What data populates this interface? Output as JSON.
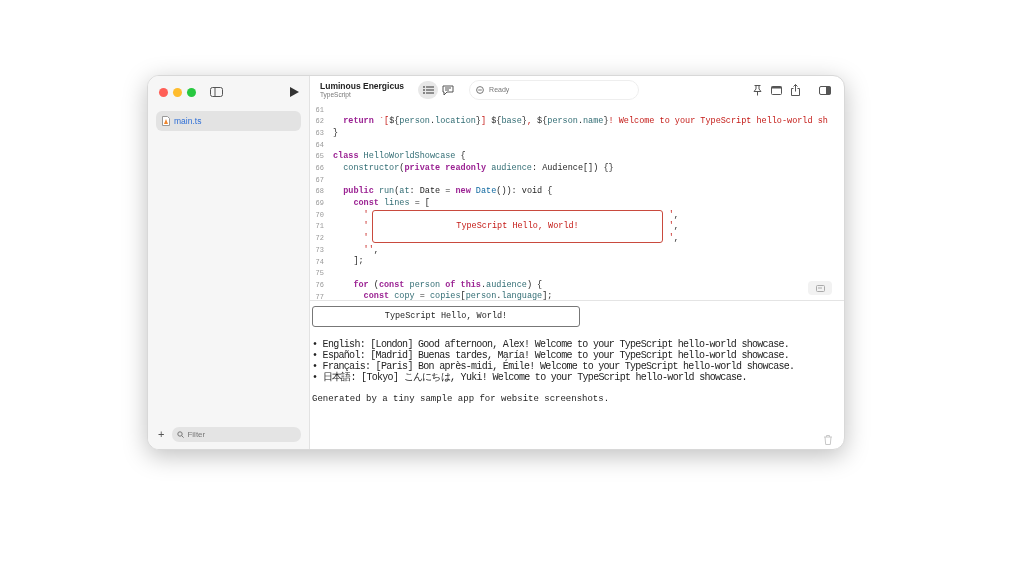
{
  "sidebar": {
    "files": [
      {
        "name": "main.ts",
        "selected": true
      }
    ],
    "filter": {
      "placeholder": "Filter"
    },
    "add_label": "+"
  },
  "toolbar": {
    "title": "Luminous Energicus",
    "subtitle": "TypeScript",
    "status": "Ready",
    "list_selected": true
  },
  "editor": {
    "lines": [
      {
        "num": "61",
        "kind": "code"
      },
      {
        "num": "62",
        "kind": "code",
        "tokens": [
          {
            "kind": "kw",
            "text": "  return"
          },
          {
            "kind": "str",
            "text": " `["
          },
          {
            "kind": "plain",
            "text": "${"
          },
          {
            "kind": "id",
            "text": "person"
          },
          {
            "kind": "plain",
            "text": "."
          },
          {
            "kind": "id",
            "text": "location"
          },
          {
            "kind": "plain",
            "text": "}"
          },
          {
            "kind": "str",
            "text": "] "
          },
          {
            "kind": "plain",
            "text": "${"
          },
          {
            "kind": "id",
            "text": "base"
          },
          {
            "kind": "plain",
            "text": "}"
          },
          {
            "kind": "str",
            "text": ", "
          },
          {
            "kind": "plain",
            "text": "${"
          },
          {
            "kind": "id",
            "text": "person"
          },
          {
            "kind": "plain",
            "text": "."
          },
          {
            "kind": "id",
            "text": "name"
          },
          {
            "kind": "plain",
            "text": "}"
          },
          {
            "kind": "str",
            "text": "! Welcome to your TypeScript hello-world sh"
          }
        ]
      },
      {
        "num": "63",
        "kind": "code",
        "tokens": [
          {
            "kind": "plain",
            "text": "}"
          }
        ]
      },
      {
        "num": "64",
        "kind": "code"
      },
      {
        "num": "65",
        "kind": "code",
        "tokens": [
          {
            "kind": "kw",
            "text": "class"
          },
          {
            "kind": "id",
            "text": " HelloWorldShowcase"
          },
          {
            "kind": "plain",
            "text": " {"
          }
        ]
      },
      {
        "num": "66",
        "kind": "code",
        "tokens": [
          {
            "kind": "id",
            "text": "  constructor"
          },
          {
            "kind": "plain",
            "text": "("
          },
          {
            "kind": "kw",
            "text": "private readonly"
          },
          {
            "kind": "id",
            "text": " audience"
          },
          {
            "kind": "plain",
            "text": ": Audience[]) {}"
          }
        ]
      },
      {
        "num": "67",
        "kind": "code"
      },
      {
        "num": "68",
        "kind": "code",
        "tokens": [
          {
            "kind": "kw",
            "text": "  public"
          },
          {
            "kind": "id",
            "text": " run"
          },
          {
            "kind": "plain",
            "text": "("
          },
          {
            "kind": "id",
            "text": "at"
          },
          {
            "kind": "plain",
            "text": ": Date = "
          },
          {
            "kind": "kw",
            "text": "new"
          },
          {
            "kind": "type",
            "text": " Date"
          },
          {
            "kind": "plain",
            "text": "()): void {"
          }
        ]
      },
      {
        "num": "69",
        "kind": "code",
        "tokens": [
          {
            "kind": "kw",
            "text": "    const"
          },
          {
            "kind": "id",
            "text": " lines"
          },
          {
            "kind": "plain",
            "text": " = ["
          }
        ]
      },
      {
        "num": "70",
        "kind": "boxed",
        "tokens": [
          {
            "kind": "str",
            "text": "      '"
          },
          {
            "kind": "str",
            "text": "'"
          },
          {
            "kind": "plain",
            "text": ","
          }
        ]
      },
      {
        "num": "71",
        "kind": "boxed",
        "tokens": [
          {
            "kind": "str",
            "text": "      '"
          },
          {
            "kind": "str",
            "text": "'"
          },
          {
            "kind": "plain",
            "text": ","
          }
        ]
      },
      {
        "num": "72",
        "kind": "boxed",
        "tokens": [
          {
            "kind": "str",
            "text": "      '"
          },
          {
            "kind": "str",
            "text": "'"
          },
          {
            "kind": "plain",
            "text": ","
          }
        ]
      },
      {
        "num": "73",
        "kind": "code",
        "tokens": [
          {
            "kind": "str",
            "text": "      ''"
          },
          {
            "kind": "plain",
            "text": ","
          }
        ]
      },
      {
        "num": "74",
        "kind": "code",
        "tokens": [
          {
            "kind": "plain",
            "text": "    ];"
          }
        ]
      },
      {
        "num": "75",
        "kind": "code"
      },
      {
        "num": "76",
        "kind": "code",
        "tokens": [
          {
            "kind": "kw",
            "text": "    for"
          },
          {
            "kind": "plain",
            "text": " ("
          },
          {
            "kind": "kw",
            "text": "const"
          },
          {
            "kind": "id",
            "text": " person"
          },
          {
            "kind": "kw",
            "text": " of this"
          },
          {
            "kind": "plain",
            "text": "."
          },
          {
            "kind": "id",
            "text": "audience"
          },
          {
            "kind": "plain",
            "text": ") {"
          }
        ]
      },
      {
        "num": "77",
        "kind": "code",
        "tokens": [
          {
            "kind": "kw",
            "text": "      const"
          },
          {
            "kind": "id",
            "text": " copy"
          },
          {
            "kind": "plain",
            "text": " = "
          },
          {
            "kind": "id",
            "text": "copies"
          },
          {
            "kind": "plain",
            "text": "["
          },
          {
            "kind": "id",
            "text": "person"
          },
          {
            "kind": "plain",
            "text": "."
          },
          {
            "kind": "id",
            "text": "language"
          },
          {
            "kind": "plain",
            "text": "];"
          }
        ]
      }
    ],
    "banner": "TypeScript Hello, World!"
  },
  "output": {
    "banner": "TypeScript Hello, World!",
    "lines": [
      "• English: [London] Good afternoon, Alex! Welcome to your TypeScript hello-world showcase.",
      "• Español: [Madrid] Buenas tardes, María! Welcome to your TypeScript hello-world showcase.",
      "• Français: [Paris] Bon après-midi, Émile! Welcome to your TypeScript hello-world showcase.",
      "• 日本語: [Tokyo] こんにちは, Yuki! Welcome to your TypeScript hello-world showcase."
    ],
    "footer": "Generated by a tiny sample app for website screenshots."
  }
}
